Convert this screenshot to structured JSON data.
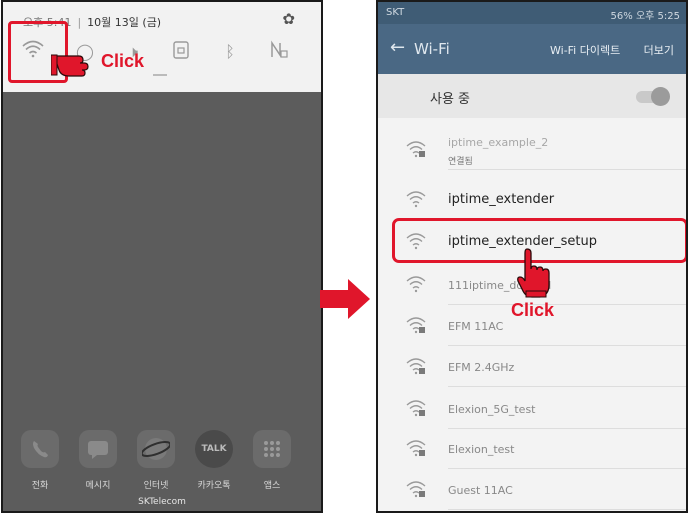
{
  "left_phone": {
    "status": {
      "time": "오후 5:41",
      "date": "10월 13일 (금)"
    },
    "quick_icons": [
      "wifi-icon",
      "location-icon",
      "sound-off-icon",
      "lock-rotation-icon",
      "bluetooth-icon",
      "nfc-icon"
    ],
    "click_label": "Click",
    "dock": [
      {
        "icon": "phone-icon",
        "label": "전화"
      },
      {
        "icon": "message-icon",
        "label": "메시지"
      },
      {
        "icon": "internet-icon",
        "label": "인터넷"
      },
      {
        "icon": "kakaotalk-icon",
        "label": "카카오톡",
        "badge": "TALK"
      },
      {
        "icon": "apps-icon",
        "label": "앱스"
      }
    ],
    "carrier": "SKTelecom"
  },
  "right_phone": {
    "status": {
      "carrier": "SKT",
      "right": "56% 오후 5:25"
    },
    "app_bar": {
      "back": "←",
      "title": "Wi-Fi",
      "direct": "Wi-Fi 다이렉트",
      "more": "더보기"
    },
    "toggle": {
      "label": "사용 중",
      "state": "on"
    },
    "networks": [
      {
        "name": "iptime_example_2",
        "status": "연결됨",
        "locked": true
      },
      {
        "name": "iptime_extender",
        "locked": false
      },
      {
        "name": "iptime_extender_setup",
        "locked": false
      },
      {
        "name": "111iptime_dddddd",
        "locked": false
      },
      {
        "name": "EFM 11AC",
        "locked": true
      },
      {
        "name": "EFM 2.4GHz",
        "locked": true
      },
      {
        "name": "Elexion_5G_test",
        "locked": true
      },
      {
        "name": "Elexion_test",
        "locked": true
      },
      {
        "name": "Guest 11AC",
        "locked": true
      }
    ],
    "click_label": "Click"
  },
  "colors": {
    "highlight": "#e0162b",
    "app_bar": "#4a6884",
    "status_bar": "#3f5c75"
  }
}
